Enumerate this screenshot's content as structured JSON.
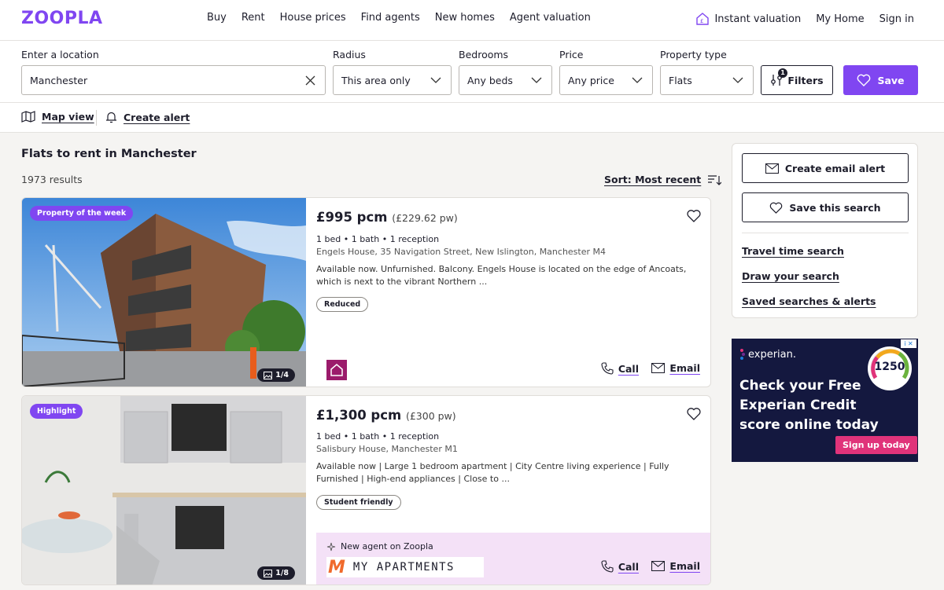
{
  "brand": {
    "logo": "ZOOPLA",
    "accent": "#8046f1"
  },
  "nav": {
    "links": [
      "Buy",
      "Rent",
      "House prices",
      "Find agents",
      "New homes",
      "Agent valuation"
    ],
    "instant_valuation": "Instant valuation",
    "my_home": "My Home",
    "sign_in": "Sign in"
  },
  "search": {
    "location_label": "Enter a location",
    "location_value": "Manchester",
    "radius_label": "Radius",
    "radius_value": "This area only",
    "bedrooms_label": "Bedrooms",
    "bedrooms_value": "Any beds",
    "price_label": "Price",
    "price_value": "Any price",
    "type_label": "Property type",
    "type_value": "Flats",
    "filters_label": "Filters",
    "filters_count": "1",
    "save_label": "Save"
  },
  "toolbar": {
    "map_view": "Map view",
    "create_alert": "Create alert"
  },
  "results": {
    "title": "Flats to rent in Manchester",
    "count": "1973 results",
    "sort": "Sort: Most recent"
  },
  "listings": [
    {
      "tag": "Property of the week",
      "photos": "1/4",
      "price": "£995 pcm",
      "price_pw": "(£229.62 pw)",
      "spec": "1 bed • 1 bath • 1 reception",
      "address": "Engels House, 35 Navigation Street, New Islington, Manchester M4",
      "description": "Available now. Unfurnished. Balcony. Engels House is located on the edge of Ancoats, which is next to the vibrant Northern ...",
      "chip": "Reduced",
      "call": "Call",
      "email": "Email"
    },
    {
      "tag": "Highlight",
      "photos": "1/8",
      "price": "£1,300 pcm",
      "price_pw": "(£300 pw)",
      "spec": "1 bed • 1 bath • 1 reception",
      "address": "Salisbury House, Manchester M1",
      "description": "Available now | Large 1 bedroom apartment | City Centre living experience | Fully Furnished | High-end appliances | Close to ...",
      "chip": "Student friendly",
      "new_agent": "New agent on Zoopla",
      "agent_name": "MY APARTMENTS",
      "call": "Call",
      "email": "Email"
    }
  ],
  "sidebar": {
    "create_email_alert": "Create email alert",
    "save_search": "Save this search",
    "links": [
      "Travel time search",
      "Draw your search",
      "Saved searches & alerts"
    ]
  },
  "ad": {
    "brand": "experian.",
    "score": "1250",
    "text": "Check your Free Experian Credit score online today",
    "cta": "Sign up today"
  }
}
